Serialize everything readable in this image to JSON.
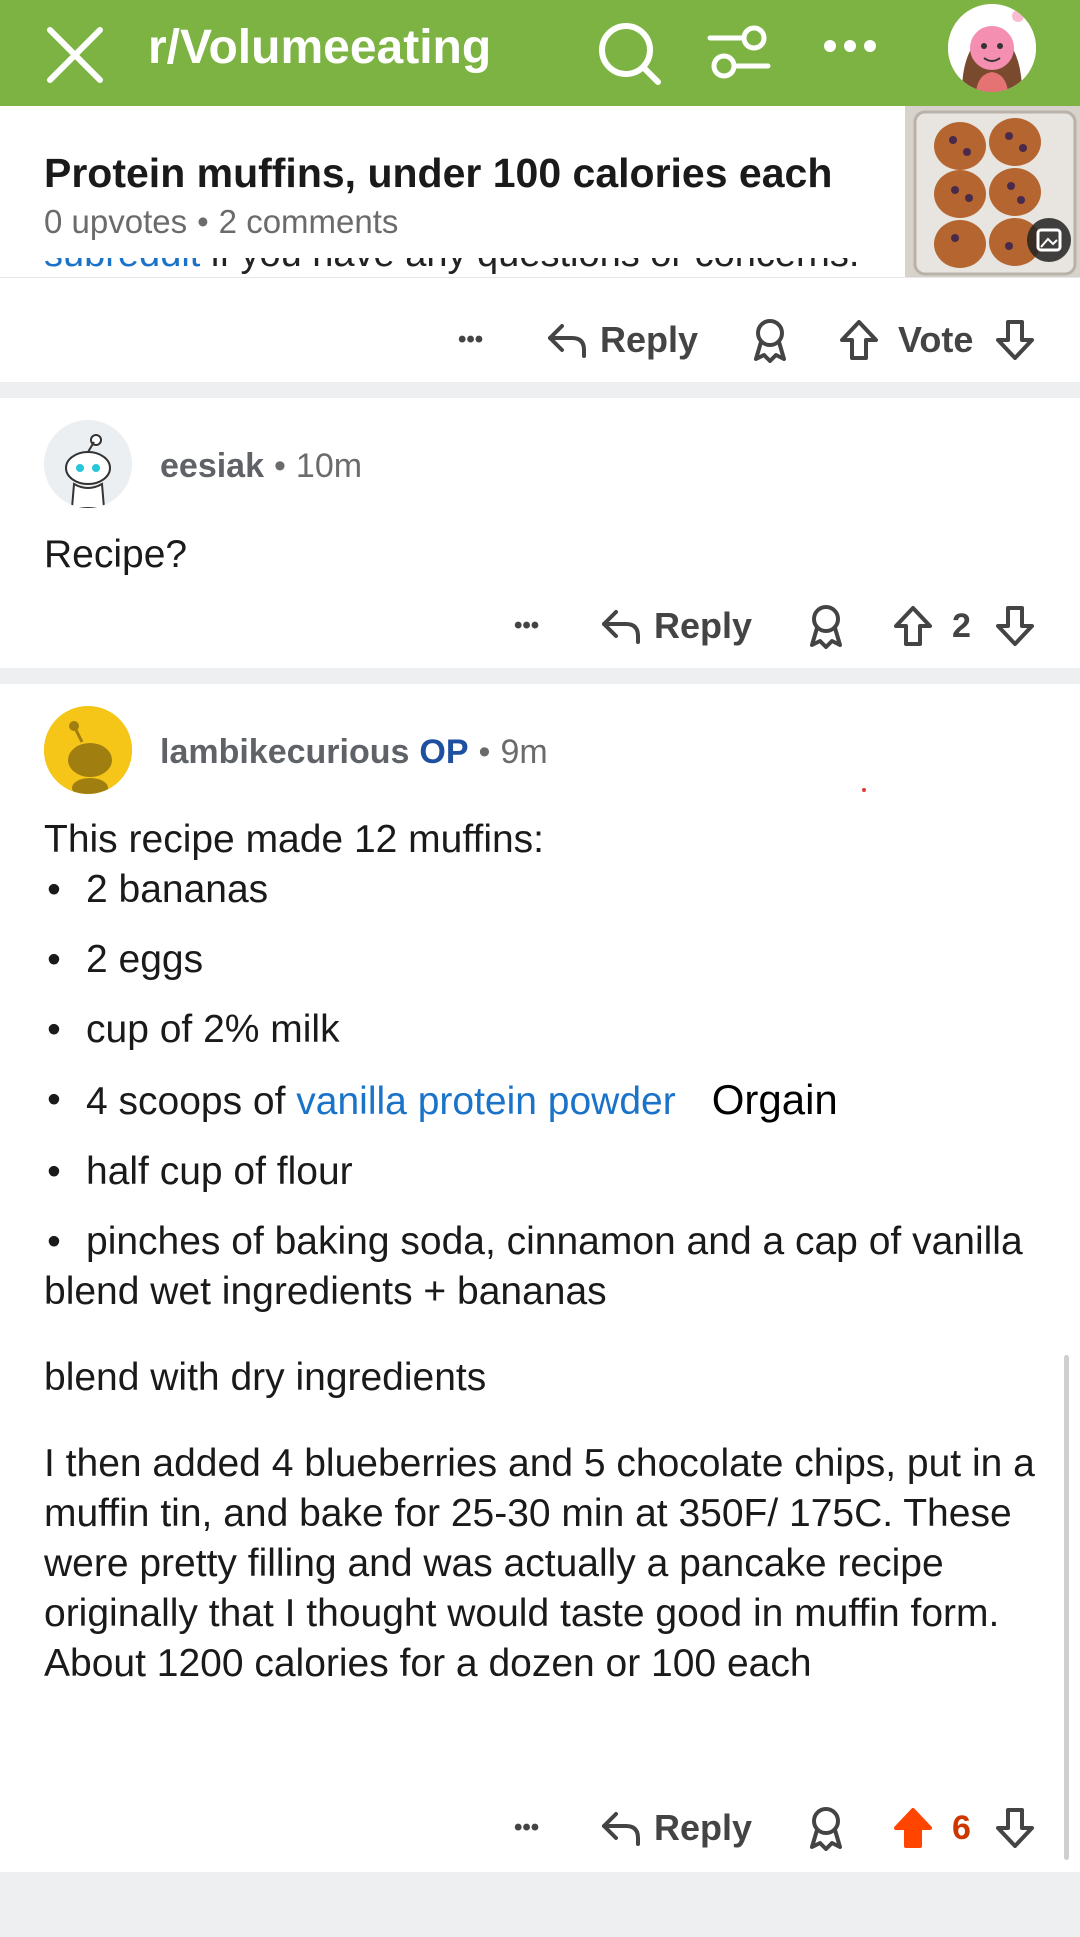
{
  "header": {
    "subreddit": "r/Volumeeating",
    "icons": [
      "close-icon",
      "search-icon",
      "filter-icon",
      "more-icon",
      "user-avatar"
    ]
  },
  "post": {
    "title": "Protein muffins, under 100 calories each",
    "upvotes": "0 upvotes",
    "comments": "2 comments",
    "separator": "•"
  },
  "mod_comment": {
    "cut_text_link": "subreddit",
    "cut_text_rest": " if you have any questions or concerns.",
    "actions": {
      "more": "•••",
      "reply": "Reply",
      "vote": "Vote"
    }
  },
  "comment1": {
    "username": "eesiak",
    "time": "10m",
    "separator": "•",
    "body": "Recipe?",
    "actions": {
      "more": "•••",
      "reply": "Reply",
      "score": "2"
    }
  },
  "comment2": {
    "username": "lambikecurious",
    "op_badge": "OP",
    "time": "9m",
    "separator": "•",
    "intro": "This recipe made 12 muffins:",
    "ingredients": [
      "2 bananas",
      "2 eggs",
      "cup of 2% milk",
      "4 scoops of ",
      "half cup of flour",
      "pinches of baking soda, cinnamon and a cap of vanilla"
    ],
    "ingredient_link": "vanilla protein powder",
    "annotation": "Orgain",
    "bullet": "•",
    "step1": "blend wet ingredients + bananas",
    "step2": "blend with dry ingredients",
    "step3": "I then added 4 blueberries and 5 chocolate chips, put in a muffin tin, and bake for 25-30 min at 350F/ 175C. These were pretty filling and was actually a pancake recipe originally that I thought would taste good in muffin form. About 1200 calories for a dozen or 100 each",
    "actions": {
      "more": "•••",
      "reply": "Reply",
      "score": "6"
    }
  },
  "colors": {
    "header_bg": "#7cb342",
    "link": "#1a73c8",
    "upvoted": "#ff4500",
    "op_badge": "#1e4fa0",
    "divider": "#edeff1"
  }
}
